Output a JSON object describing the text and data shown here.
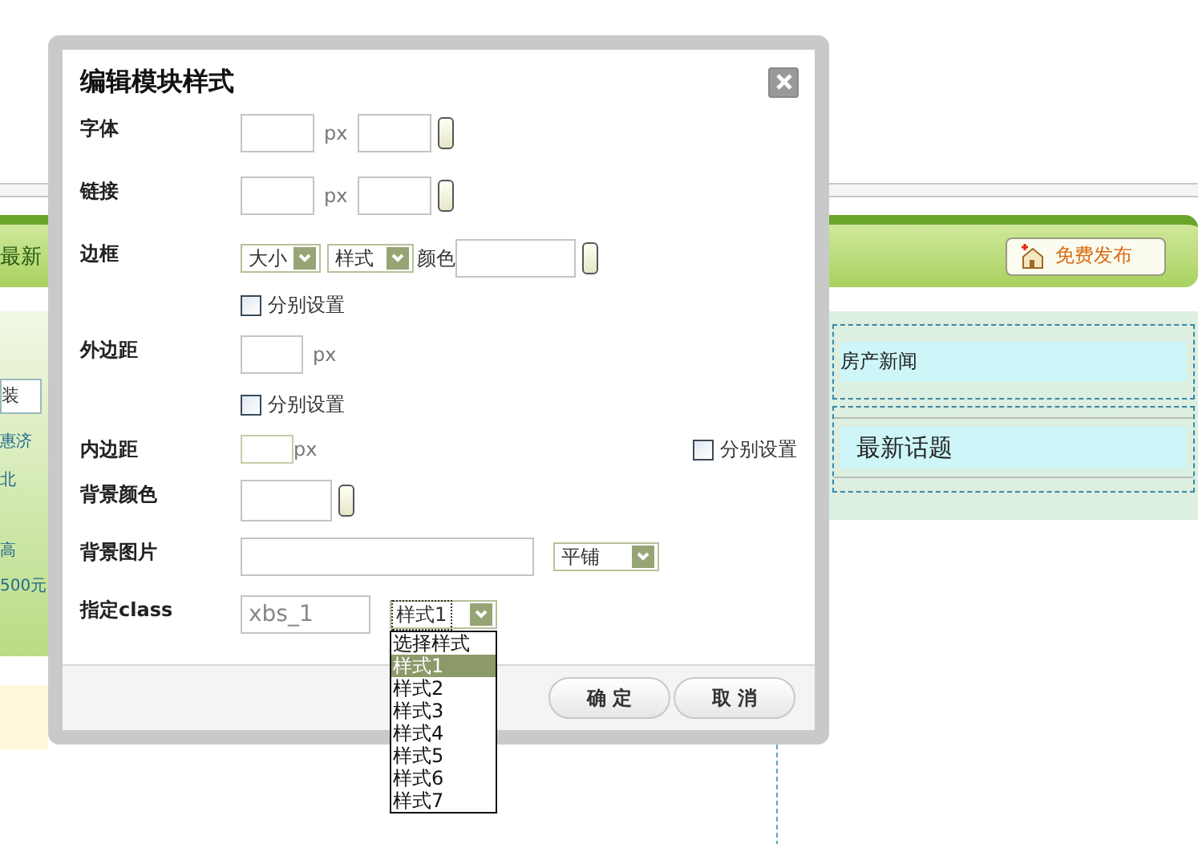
{
  "page": {
    "header_text": "最新",
    "publish_button": "免费发布",
    "left_field": "装",
    "left_texts": [
      "惠济",
      "北",
      "高",
      "500元"
    ],
    "right_panels": [
      {
        "kind": "small",
        "title": "房产新闻"
      },
      {
        "kind": "large",
        "title": "最新话题"
      }
    ]
  },
  "dialog": {
    "title": "编辑模块样式",
    "rows": [
      {
        "kind": "px_color",
        "label": "字体",
        "unit": "px"
      },
      {
        "kind": "px_color",
        "label": "链接",
        "unit": "px"
      },
      {
        "kind": "border",
        "label": "边框",
        "selects": [
          "大小",
          "样式"
        ],
        "color_label": "颜色"
      },
      {
        "kind": "checkbox",
        "option": "分别设置",
        "checked": false
      },
      {
        "kind": "px",
        "label": "外边距",
        "unit": "px"
      },
      {
        "kind": "checkbox",
        "option": "分别设置",
        "checked": false
      },
      {
        "kind": "px_check",
        "label": "内边距",
        "unit": "px",
        "option": "分别设置",
        "checked": false
      },
      {
        "kind": "color",
        "label": "背景颜色"
      },
      {
        "kind": "image",
        "label": "背景图片",
        "select": "平铺"
      },
      {
        "kind": "class",
        "label": "指定class",
        "value": "xbs_1",
        "select": "样式1",
        "options": [
          {
            "label": "选择样式",
            "selected": false
          },
          {
            "label": "样式1",
            "selected": true
          },
          {
            "label": "样式2",
            "selected": false
          },
          {
            "label": "样式3",
            "selected": false
          },
          {
            "label": "样式4",
            "selected": false
          },
          {
            "label": "样式5",
            "selected": false
          },
          {
            "label": "样式6",
            "selected": false
          },
          {
            "label": "样式7",
            "selected": false
          }
        ]
      }
    ],
    "buttons": [
      "确 定",
      "取 消"
    ]
  }
}
